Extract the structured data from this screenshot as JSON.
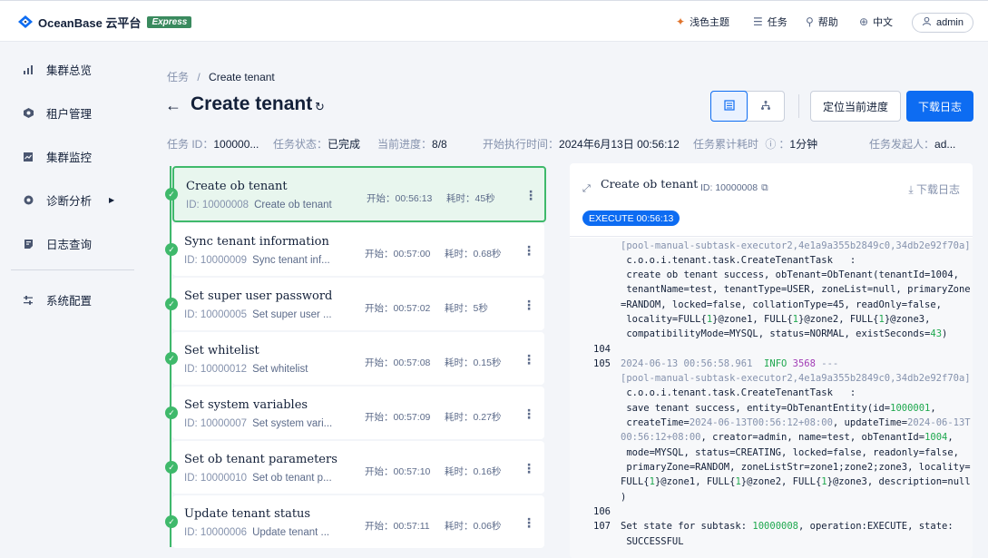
{
  "topbar": {
    "logo_text": "OceanBase 云平台",
    "logo_badge": "Express",
    "theme": "浅色主题",
    "tasks": "任务",
    "help": "帮助",
    "lang": "中文",
    "user": "admin"
  },
  "sidebar": {
    "items": [
      {
        "label": "集群总览",
        "icon": "bar-chart-icon"
      },
      {
        "label": "租户管理",
        "icon": "tenant-icon"
      },
      {
        "label": "集群监控",
        "icon": "monitor-icon"
      },
      {
        "label": "诊断分析",
        "icon": "diagnose-icon"
      },
      {
        "label": "日志查询",
        "icon": "log-icon"
      },
      {
        "label": "系统配置",
        "icon": "settings-icon"
      }
    ]
  },
  "breadcrumb": {
    "parent": "任务",
    "sep": "/",
    "current": "Create tenant"
  },
  "header": {
    "title": "Create tenant",
    "locate_label": "定位当前进度",
    "download_label": "下载日志"
  },
  "meta": {
    "task_id_label": "任务 ID：",
    "task_id_value": "100000...",
    "status_label": "任务状态：",
    "status_value": "已完成",
    "progress_label": "当前进度：",
    "progress_value": "8/8",
    "start_label": "开始执行时间：",
    "start_value": "2024年6月13日 00:56:12",
    "elapsed_label": "任务累计耗时",
    "elapsed_value": "1分钟",
    "initiator_label": "任务发起人：",
    "initiator_value": "ad..."
  },
  "tasks": [
    {
      "name": "Create ob tenant",
      "id": "ID: 10000008",
      "desc": "Create ob tenant",
      "start": "开始：00:56:13",
      "dur": "耗时：45秒"
    },
    {
      "name": "Sync tenant information",
      "id": "ID: 10000009",
      "desc": "Sync tenant inf...",
      "start": "开始：00:57:00",
      "dur": "耗时：0.68秒"
    },
    {
      "name": "Set super user password",
      "id": "ID: 10000005",
      "desc": "Set super user ...",
      "start": "开始：00:57:02",
      "dur": "耗时：5秒"
    },
    {
      "name": "Set whitelist",
      "id": "ID: 10000012",
      "desc": "Set whitelist",
      "start": "开始：00:57:08",
      "dur": "耗时：0.15秒"
    },
    {
      "name": "Set system variables",
      "id": "ID: 10000007",
      "desc": "Set system vari...",
      "start": "开始：00:57:09",
      "dur": "耗时：0.27秒"
    },
    {
      "name": "Set ob tenant parameters",
      "id": "ID: 10000010",
      "desc": "Set ob tenant p...",
      "start": "开始：00:57:10",
      "dur": "耗时：0.16秒"
    },
    {
      "name": "Update tenant status",
      "id": "ID: 10000006",
      "desc": "Update tenant ...",
      "start": "开始：00:57:11",
      "dur": "耗时：0.06秒"
    }
  ],
  "log_panel": {
    "title": "Create ob tenant",
    "id": "ID: 10000008",
    "download": "下载日志",
    "badge": "EXECUTE 00:56:13",
    "lines": {
      "l1": "[pool-manual-subtask-executor2,4e1a9a355b2849c0,34db2e92f70a]",
      "l2": " c.o.o.i.tenant.task.CreateTenantTask   :",
      "l3": " create ob tenant success, obTenant=ObTenant(tenantId=1004,",
      "l4": " tenantName=test, tenantType=USER, zoneList=null, primaryZone",
      "l5": "=RANDOM, locked=false, collationType=45, readOnly=false,",
      "l6a": " locality=FULL{",
      "l6b": "1",
      "l6c": "}@zone1, FULL{",
      "l6d": "1",
      "l6e": "}@zone2, FULL{",
      "l6f": "1",
      "l6g": "}@zone3,",
      "l7a": " compatibilityMode=MYSQL, status=NORMAL, existSeconds=",
      "l7b": "43",
      "l7c": ")",
      "n104": "104",
      "n105": "105",
      "l9a": "2024-06-13 00:56:58.961  ",
      "l9b": "INFO",
      "l9c": " 3568",
      "l9d": " ---",
      "l10": "[pool-manual-subtask-executor2,4e1a9a355b2849c0,34db2e92f70a]",
      "l11": " c.o.o.i.tenant.task.CreateTenantTask   :",
      "l12a": " save tenant success, entity=ObTenantEntity(id=",
      "l12b": "1000001",
      "l12c": ",",
      "l13a": " createTime=",
      "l13b": "2024-06-13T00:56:12+08:00",
      "l13c": ", updateTime=",
      "l13d": "2024-06-13T",
      "l14a": "00:56:12+08:00",
      "l14b": ", creator=admin, name=test, obTenantId=",
      "l14c": "1004",
      "l14d": ",",
      "l15": " mode=MYSQL, status=CREATING, locked=false, readonly=false,",
      "l16": " primaryZone=RANDOM, zoneListStr=zone1;zone2;zone3, locality=",
      "l17a": "FULL{",
      "l17b": "1",
      "l17c": "}@zone1, FULL{",
      "l17d": "1",
      "l17e": "}@zone2, FULL{",
      "l17f": "1",
      "l17g": "}@zone3, description=null",
      "l18": ")",
      "n106": "106",
      "n107": "107",
      "l20a": "Set state for subtask: ",
      "l20b": "10000008",
      "l20c": ", operation:EXECUTE, state:",
      "l21": " SUCCESSFUL"
    }
  }
}
